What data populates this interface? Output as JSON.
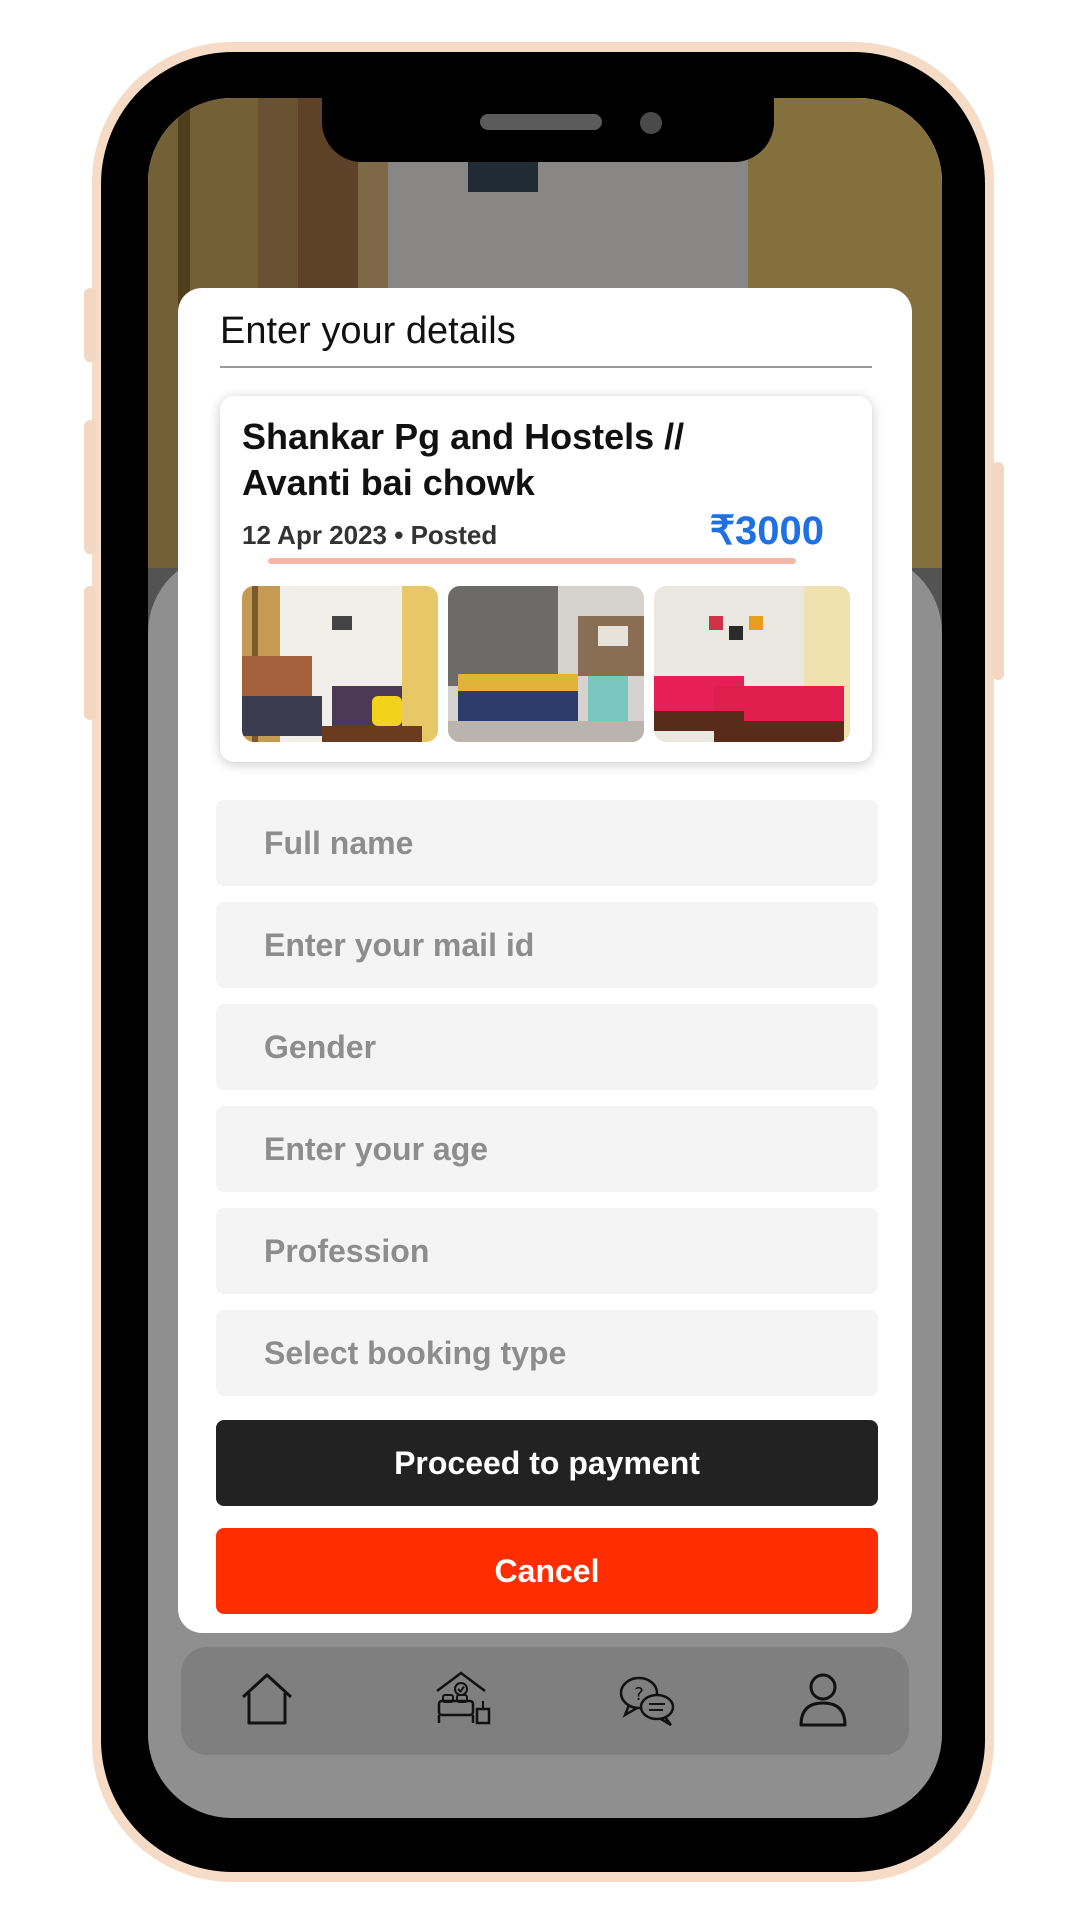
{
  "modal": {
    "title": "Enter your details"
  },
  "listing": {
    "name": "Shankar Pg and Hostels // Avanti bai chowk",
    "date_status": "12 Apr 2023 • Posted",
    "price": "₹3000",
    "photos": [
      "room-photo-1",
      "room-photo-2",
      "room-photo-3"
    ]
  },
  "form": {
    "full_name_placeholder": "Full name",
    "email_placeholder": "Enter your mail id",
    "gender_placeholder": "Gender",
    "age_placeholder": "Enter your age",
    "profession_placeholder": "Profession",
    "booking_type_placeholder": "Select booking type"
  },
  "buttons": {
    "proceed": "Proceed to payment",
    "cancel": "Cancel"
  },
  "bottom_nav": {
    "items": [
      {
        "icon": "home-icon"
      },
      {
        "icon": "room-booking-icon"
      },
      {
        "icon": "chat-help-icon"
      },
      {
        "icon": "profile-icon"
      }
    ]
  },
  "colors": {
    "price_blue": "#1f6fe5",
    "cancel_red": "#ff2d00",
    "proceed_dark": "#222222",
    "accent_peach": "#f4b6a6"
  }
}
